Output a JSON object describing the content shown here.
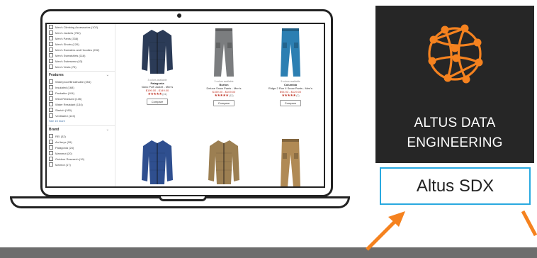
{
  "sidebar": {
    "top_filters": [
      "Men's Climbing Accessories (102)",
      "Men's Jackets (752)",
      "Men's Pants (338)",
      "Men's Shorts (126)",
      "Men's Sweaters and Hoodies (202)",
      "Men's Sweatshirts (116)",
      "Men's Swimwear (43)",
      "Men's Vests (76)"
    ],
    "features": {
      "title": "Features",
      "items": [
        "Waterproof/Breathable (354)",
        "Insulated (168)",
        "Packable (104)",
        "Wind Resistant (135)",
        "Water Resistant (134)",
        "Stretch (180)",
        "Ventilated (124)"
      ],
      "see_more": "See 15 more"
    },
    "brand": {
      "title": "Brand",
      "items": [
        "REI (32)",
        "Arc'teryx (26)",
        "Patagonia (24)",
        "Mammut (20)",
        "Outdoor Research (19)",
        "Marmot (17)"
      ]
    }
  },
  "products": [
    {
      "avail": "3 colors available",
      "brand": "Patagonia",
      "name": "Nano Puff Jacket - Men's",
      "price": "$199.00 - $149.00",
      "stars": "★★★★★",
      "reviews": "(41)",
      "compare": "Compare",
      "color": "#2b3b57",
      "shape": "jacket"
    },
    {
      "avail": "3 colors available",
      "brand": "Burton",
      "name": "Deluxe Snow Pants - Men's",
      "price": "$159.00 - $109.00",
      "stars": "★★★★★",
      "reviews": "(12)",
      "compare": "Compare",
      "color": "#7b7d7f",
      "shape": "pants"
    },
    {
      "avail": "5 colors available",
      "brand": "Columbia",
      "name": "Ridge 2 Run II Snow Pants - Men's",
      "price": "$94.93 - $129.00",
      "stars": "★★★★★",
      "reviews": "(7)",
      "compare": "Compare",
      "color": "#2c7fb2",
      "shape": "pants"
    },
    {
      "avail": "",
      "brand": "",
      "name": "",
      "price": "",
      "stars": "",
      "reviews": "",
      "compare": "",
      "color": "#2f4f8f",
      "shape": "jacket"
    },
    {
      "avail": "",
      "brand": "",
      "name": "",
      "price": "",
      "stars": "",
      "reviews": "",
      "compare": "",
      "color": "#9c7f52",
      "shape": "jacket"
    },
    {
      "avail": "",
      "brand": "",
      "name": "",
      "price": "",
      "stars": "",
      "reviews": "",
      "compare": "",
      "color": "#b08a55",
      "shape": "pants"
    }
  ],
  "altus": {
    "line1": "ALTUS DATA",
    "line2": "ENGINEERING",
    "logo_icon": "network-globe-icon",
    "logo_color": "#f5821f"
  },
  "sdx": {
    "label": "Altus SDX",
    "border_color": "#29a9e0"
  },
  "arrow_color": "#f5821f"
}
